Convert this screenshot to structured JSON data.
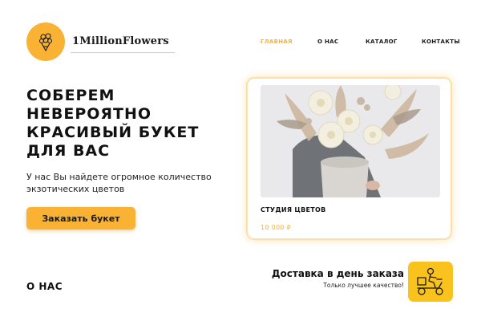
{
  "brand": {
    "name": "1MillionFlowers",
    "logo_icon": "bouquet-icon"
  },
  "nav": [
    {
      "label": "ГЛАВНАЯ",
      "active": true
    },
    {
      "label": "О НАС",
      "active": false
    },
    {
      "label": "КАТАЛОГ",
      "active": false
    },
    {
      "label": "КОНТАКТЫ",
      "active": false
    }
  ],
  "hero": {
    "title": "СОБЕРЕМ НЕВЕРОЯТНО КРАСИВЫЙ БУКЕТ ДЛЯ ВАС",
    "text": "У нас Вы найдете огромное количество экзотических цветов",
    "cta_label": "Заказать букет"
  },
  "card": {
    "image_icon": "bouquet-photo",
    "title": "СТУДИЯ ЦВЕТОВ",
    "price": "10 000 ₽"
  },
  "about": {
    "title": "О НАС"
  },
  "delivery": {
    "title": "Доставка в день заказа",
    "subtitle": "Только лучшее качество!",
    "icon": "delivery-scooter-icon"
  },
  "colors": {
    "accent": "#f9b233",
    "badge": "#f9c21c"
  }
}
